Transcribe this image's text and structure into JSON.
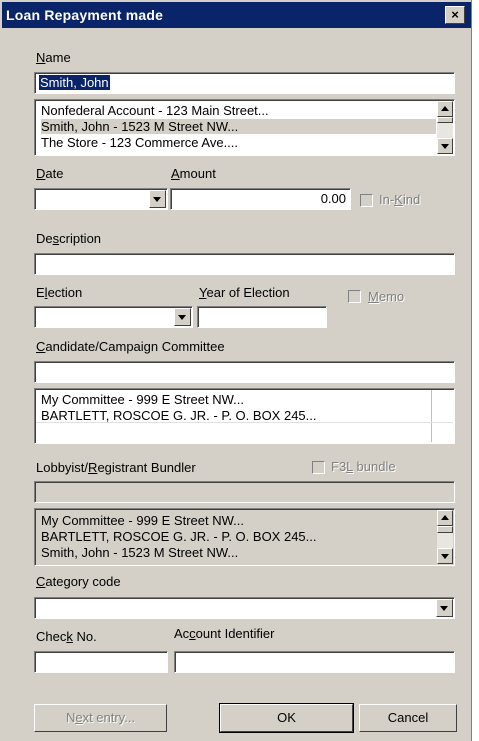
{
  "window": {
    "title": "Loan Repayment made",
    "close_glyph": "×"
  },
  "name": {
    "label_u": "N",
    "label_rest": "ame",
    "value": "Smith, John",
    "list": [
      "Nonfederal Account - 123 Main Street...",
      "Smith, John - 1523 M Street NW...",
      "The Store - 123 Commerce Ave...."
    ]
  },
  "date": {
    "label_u": "D",
    "label_rest": "ate",
    "value": ""
  },
  "amount": {
    "label_u": "A",
    "label_rest": "mount",
    "value": "0.00"
  },
  "inkind": {
    "label_pre": "In-",
    "label_u": "K",
    "label_rest": "ind"
  },
  "description": {
    "label_pre": "De",
    "label_u": "s",
    "label_rest": "cription",
    "value": ""
  },
  "election": {
    "label_pre": "E",
    "label_u": "l",
    "label_rest": "ection",
    "value": ""
  },
  "year_of_election": {
    "label_u": "Y",
    "label_rest": "ear of Election",
    "value": ""
  },
  "memo": {
    "label_u": "M",
    "label_rest": "emo"
  },
  "candidate": {
    "label_u": "C",
    "label_rest": "andidate/Campaign Committee",
    "value": "",
    "list": [
      "My Committee - 999 E Street NW...",
      "BARTLETT, ROSCOE G. JR. - P. O. BOX 245..."
    ]
  },
  "lobbyist": {
    "label_pre": "Lobbyist/",
    "label_u": "R",
    "label_rest": "egistrant Bundler",
    "f3l_pre": "F3",
    "f3l_u": "L",
    "f3l_rest": " bundle",
    "value": "",
    "list": [
      "My Committee - 999 E Street NW...",
      "BARTLETT, ROSCOE G. JR. - P. O. BOX 245...",
      "Smith, John - 1523 M Street NW..."
    ]
  },
  "category": {
    "label_u": "C",
    "label_rest": "ategory code",
    "value": ""
  },
  "check": {
    "label_pre": "Chec",
    "label_u": "k",
    "label_rest": " No.",
    "value": ""
  },
  "account_id": {
    "label_pre": "Ac",
    "label_u": "c",
    "label_rest": "ount Identifier",
    "value": ""
  },
  "buttons": {
    "next_pre": "N",
    "next_u": "e",
    "next_rest": "xt entry...",
    "ok": "OK",
    "cancel": "Cancel"
  },
  "colors": {
    "title_bar": "#0a246a",
    "face": "#d4d0c8"
  }
}
